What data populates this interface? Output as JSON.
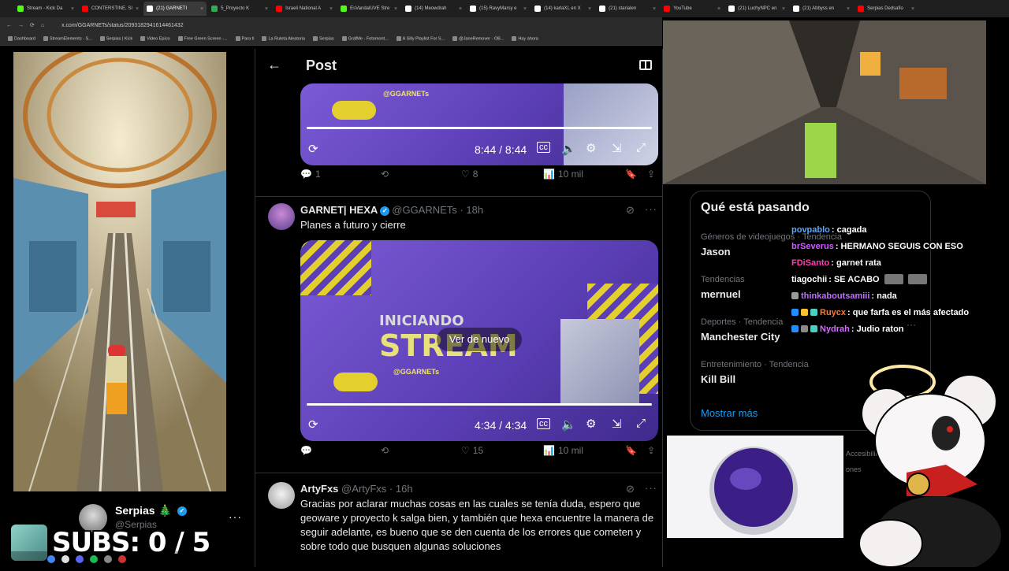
{
  "browser": {
    "tabs": [
      {
        "label": "Stream - Kick Da",
        "color": "#53fc18"
      },
      {
        "label": "CONTERSTINE, SI",
        "color": "#ff0000"
      },
      {
        "label": "(21) GARNETI",
        "color": "#ffffff",
        "active": true
      },
      {
        "label": "5_Proyecto K",
        "color": "#34a853"
      },
      {
        "label": "Israeli National A",
        "color": "#ff0000"
      },
      {
        "label": "EsVandalUVE Stre",
        "color": "#53fc18"
      },
      {
        "label": "(14) Meowdrah",
        "color": "#ffffff"
      },
      {
        "label": "(15) RavyMarsy e",
        "color": "#ffffff"
      },
      {
        "label": "(14) karlaXL en X",
        "color": "#ffffff"
      },
      {
        "label": "(21) starialen",
        "color": "#ffffff"
      },
      {
        "label": "YouTube",
        "color": "#ff0000"
      },
      {
        "label": "(21) LuchyNPC en",
        "color": "#ffffff"
      },
      {
        "label": "(21) Abbyss en",
        "color": "#ffffff"
      },
      {
        "label": "Serpias Dedsafio",
        "color": "#ff0000"
      }
    ],
    "url": "x.com/GGARNETs/status/2093182941614461432",
    "bookmarks": [
      "Dashboard",
      "StreamElements - S...",
      "Serpias | Kick",
      "Video Epico",
      "Free Green Screen -...",
      "Para ti",
      "La Ruleta Aleatoria",
      "Serpias",
      "GrafMe - Fotomont...",
      "A Silly Playlist For S...",
      "@JaneRemover - OB...",
      "Hay ahora"
    ]
  },
  "profile": {
    "name": "Serpias 🎄",
    "handle": "@Serpias",
    "more": "···"
  },
  "overlay": {
    "subs_text": "SUBS: 0 / 5"
  },
  "post": {
    "header_title": "Post",
    "back_icon": "arrow-left-icon",
    "video1": {
      "time": "8:44 / 8:44",
      "handle_mark": "@GGARNETs",
      "progress": 1.0
    },
    "tweet1_actions": {
      "replies": "1",
      "retweets": "",
      "likes": "8",
      "views": "10 mil"
    },
    "tweet2": {
      "name": "GARNET| HEXA",
      "handle": "@GGARNETs",
      "time": "· 18h",
      "text": "Planes a futuro y cierre",
      "video_overlay_word1": "INICIANDO",
      "video_overlay_word2": "STREAM",
      "handle_mark": "@GGARNETs",
      "replay_label": "Ver de nuevo",
      "time_label": "4:34 / 4:34",
      "progress": 1.0
    },
    "tweet2_actions": {
      "replies": "",
      "retweets": "",
      "likes": "15",
      "views": "10 mil"
    },
    "tweet3": {
      "name": "ArtyFxs",
      "handle": "@ArtyFxs",
      "time": "· 16h",
      "text": "Gracias por aclarar muchas cosas en las cuales se tenía duda, espero que geoware y proyecto k salga bien, y también que hexa encuentre la manera de seguir adelante, es bueno que se den cuenta de los errores que cometen y sobre todo que busquen algunas soluciones"
    }
  },
  "trends": {
    "title": "Qué está pasando",
    "items": [
      {
        "category": "Géneros de videojuegos · Tendencia",
        "name": "Jason"
      },
      {
        "category": "Tendencias",
        "name": "mernuel"
      },
      {
        "category": "Deportes · Tendencia",
        "name": "Manchester City"
      },
      {
        "category": "Entretenimiento · Tendencia",
        "name": "Kill Bill"
      }
    ],
    "show_more": "Mostrar más"
  },
  "chat": [
    {
      "user": "povpablo",
      "color": "#5aa9ff",
      "msg": ": cagada",
      "badges": [],
      "emotes": 0
    },
    {
      "user": "brSeverus",
      "color": "#d05bff",
      "msg": ": HERMANO SEGUIS CON ESO",
      "badges": [],
      "emotes": 0
    },
    {
      "user": "FDiSanto",
      "color": "#ff3fb4",
      "msg": ": garnet rata",
      "badges": [],
      "emotes": 0
    },
    {
      "user": "tiagochii",
      "color": "#ffffff",
      "msg": ": SE ACABO",
      "badges": [],
      "emotes": 2
    },
    {
      "user": "thinkaboutsamiii",
      "color": "#c070ff",
      "msg": ": nada",
      "badges": [
        "#9a9a9a"
      ],
      "emotes": 0
    },
    {
      "user": "Ruycx",
      "color": "#ff7a2f",
      "msg": ": que farfa es el más afectado",
      "badges": [
        "#1e90ff",
        "#f2c230",
        "#4ad0c0"
      ],
      "emotes": 0
    },
    {
      "user": "Nydrah",
      "color": "#d66bff",
      "msg": ": Judio raton",
      "badges": [
        "#1e90ff",
        "#8a8a8a",
        "#4ad0c0"
      ],
      "emotes": 0
    }
  ],
  "footer": {
    "line1": "Accesibilid",
    "line2": "ones"
  }
}
